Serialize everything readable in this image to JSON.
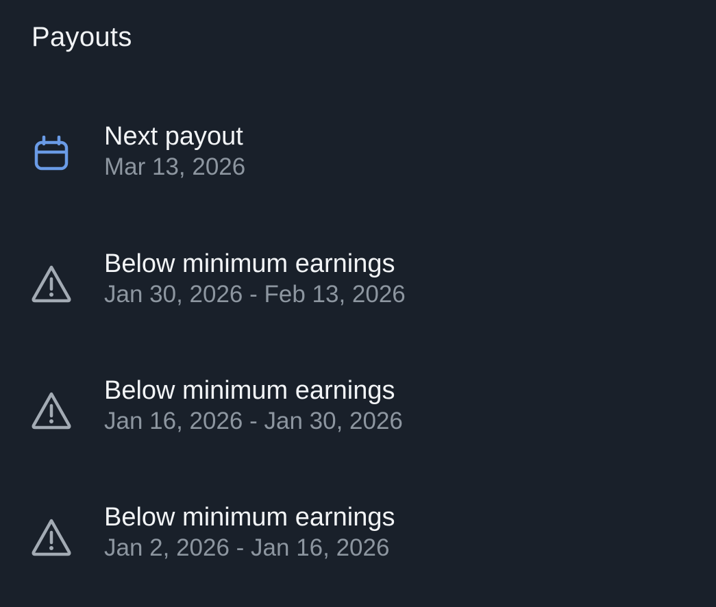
{
  "header": {
    "title": "Payouts"
  },
  "colors": {
    "background": "#19202a",
    "accent": "#6a9be6",
    "warning_icon": "#a3abb4",
    "primary_text": "#f2f4f6",
    "secondary_text": "#8d96a0"
  },
  "payouts": [
    {
      "icon": "calendar-icon",
      "label": "Next payout",
      "date": "Mar 13, 2026"
    },
    {
      "icon": "warning-icon",
      "label": "Below minimum earnings",
      "date": "Jan 30, 2026 - Feb 13, 2026"
    },
    {
      "icon": "warning-icon",
      "label": "Below minimum earnings",
      "date": "Jan 16, 2026 - Jan 30, 2026"
    },
    {
      "icon": "warning-icon",
      "label": "Below minimum earnings",
      "date": "Jan 2, 2026 - Jan 16, 2026"
    }
  ]
}
